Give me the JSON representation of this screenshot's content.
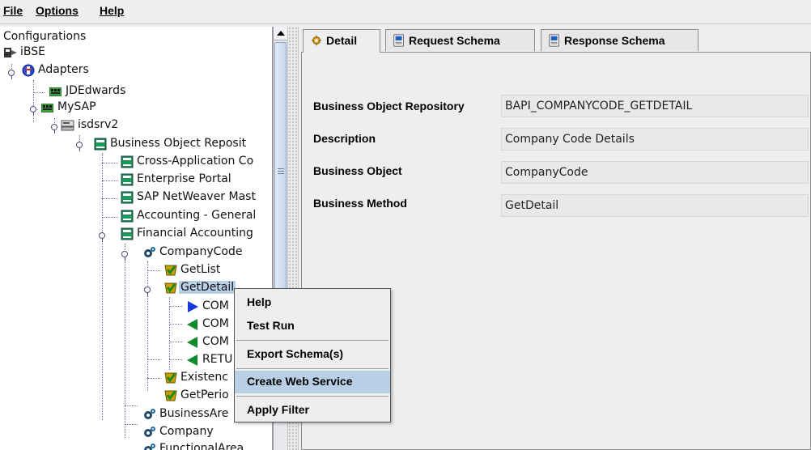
{
  "menubar": {
    "file": "File",
    "options": "Options",
    "help": "Help"
  },
  "tree": {
    "root": "Configurations",
    "ibse": "iBSE",
    "adapters": "Adapters",
    "jdedwards": "JDEdwards",
    "mysap": "MySAP",
    "isdsrv2": "isdsrv2",
    "bor": "Business Object Reposit",
    "cross_app": "Cross-Application Co",
    "enterprise_portal": "Enterprise Portal",
    "sap_netweaver": "SAP NetWeaver Mast",
    "accounting_general": "Accounting - General",
    "financial_accounting": "Financial Accounting",
    "companycode": "CompanyCode",
    "getlist": "GetList",
    "getdetail": "GetDetail",
    "com1": "COM",
    "com2": "COM",
    "com3": "COM",
    "retu": "RETU",
    "existence": "Existenc",
    "getperiod": "GetPerio",
    "businessarea": "BusinessAre",
    "company": "Company",
    "functionalarea": "FunctionalArea"
  },
  "tabs": {
    "detail": "Detail",
    "request_schema": "Request Schema",
    "response_schema": "Response Schema"
  },
  "detail": {
    "bor_label": "Business Object Repository",
    "bor_value": "BAPI_COMPANYCODE_GETDETAIL",
    "desc_label": "Description",
    "desc_value": "Company Code Details",
    "bo_label": "Business Object",
    "bo_value": "CompanyCode",
    "bm_label": "Business Method",
    "bm_value": "GetDetail"
  },
  "context_menu": {
    "help": "Help",
    "test_run": "Test Run",
    "export_schema": "Export Schema(s)",
    "create_web_service": "Create Web Service",
    "apply_filter": "Apply Filter"
  },
  "colors": {
    "selection": "#b8cfe5",
    "panel_bg": "#eeeeee",
    "tree_bg": "#ffffff"
  }
}
